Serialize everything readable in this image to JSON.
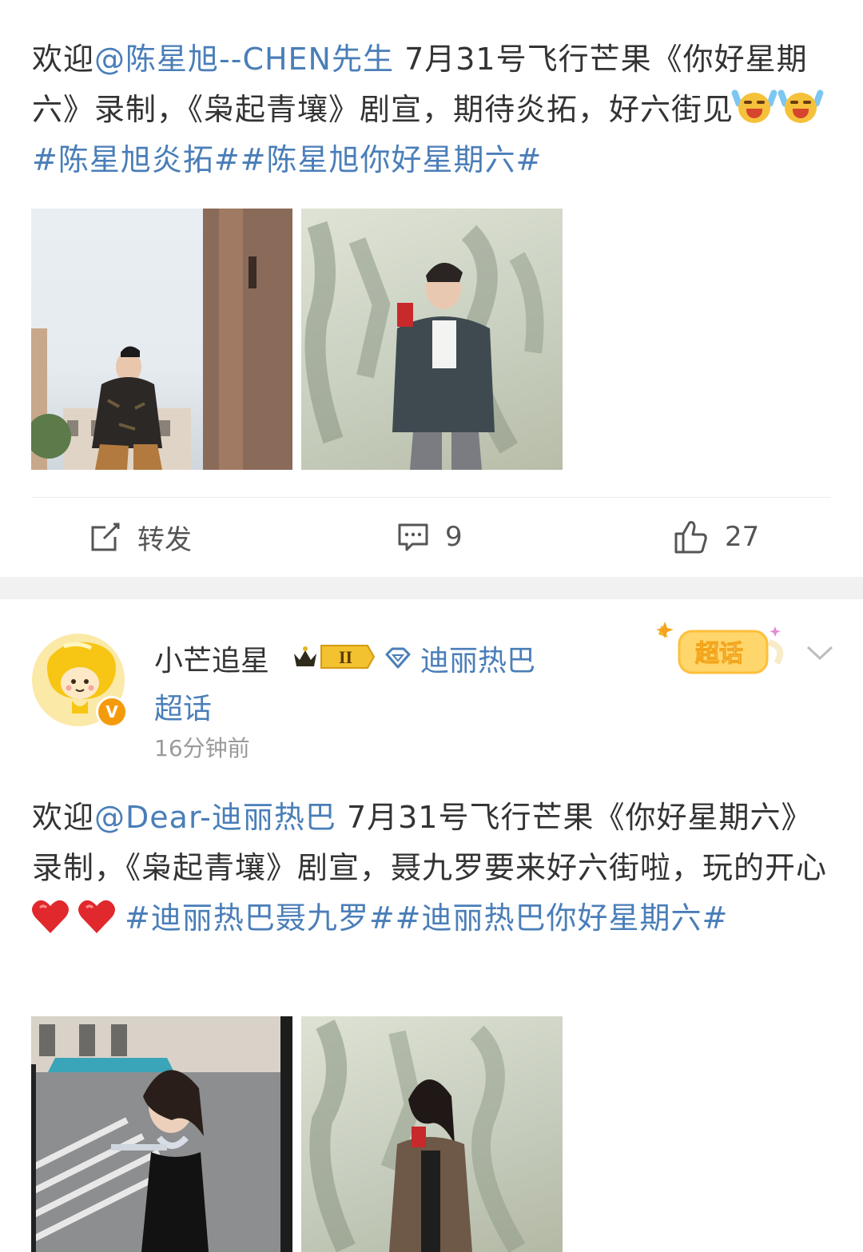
{
  "post1": {
    "text": {
      "p1": "欢迎",
      "mention": "@陈星旭--CHEN先生",
      "p2": " 7月31号飞行芒果《你好星期六》录制，《枭起青壤》剧宣，期待炎拓，好六街见",
      "hashtags": "#陈星旭炎拓##陈星旭你好星期六#"
    },
    "emojis": [
      "crying-laughing-emoji",
      "crying-laughing-emoji"
    ],
    "actions": {
      "repost_label": "转发",
      "comments_count": "9",
      "likes_count": "27"
    }
  },
  "post2": {
    "author": {
      "name": "小芒追星",
      "level": "II",
      "topic": "迪丽热巴",
      "topic_suffix": "超话",
      "time": "16分钟前",
      "badge_text": "超话",
      "verified_mark": "V"
    },
    "text": {
      "p1": "欢迎",
      "mention": "@Dear-迪丽热巴",
      "p2": " 7月31号飞行芒果《你好星期六》录制，《枭起青壤》剧宣，聂九罗要来好六街啦，玩的开心",
      "hashtags": "#迪丽热巴聂九罗##迪丽热巴你好星期六#"
    },
    "emojis": [
      "red-heart-emoji",
      "red-heart-emoji"
    ]
  },
  "colors": {
    "link": "#4a7eb8",
    "text": "#333333",
    "meta": "#9a9a9a",
    "separator": "#f1f1f1",
    "heart": "#e0282d",
    "verified": "#f49b0d"
  }
}
